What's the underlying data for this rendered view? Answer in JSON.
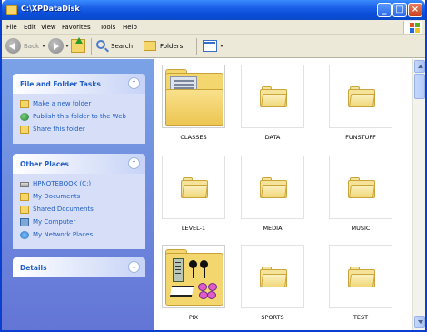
{
  "window": {
    "title": "C:\\XPDataDisk"
  },
  "menu": [
    "File",
    "Edit",
    "View",
    "Favorites",
    "Tools",
    "Help"
  ],
  "toolbar": {
    "back_label": "Back",
    "search_label": "Search",
    "folders_label": "Folders"
  },
  "file_tasks": {
    "title": "File and Folder Tasks",
    "items": [
      "Make a new folder",
      "Publish this folder to the Web",
      "Share this folder"
    ]
  },
  "other_places": {
    "title": "Other Places",
    "items": [
      "HPNOTEBOOK (C:)",
      "My Documents",
      "Shared Documents",
      "My Computer",
      "My Network Places"
    ]
  },
  "details": {
    "title": "Details"
  },
  "folders": [
    "CLASSES",
    "DATA",
    "FUNSTUFF",
    "LEVEL-1",
    "MEDIA",
    "MUSIC",
    "PIX",
    "SPORTS",
    "TEST"
  ],
  "colors": {
    "titlebar": "#0a4ed8",
    "taskpane": "#6d8fe0",
    "link": "#215dc6",
    "folder": "#f4d66f"
  }
}
